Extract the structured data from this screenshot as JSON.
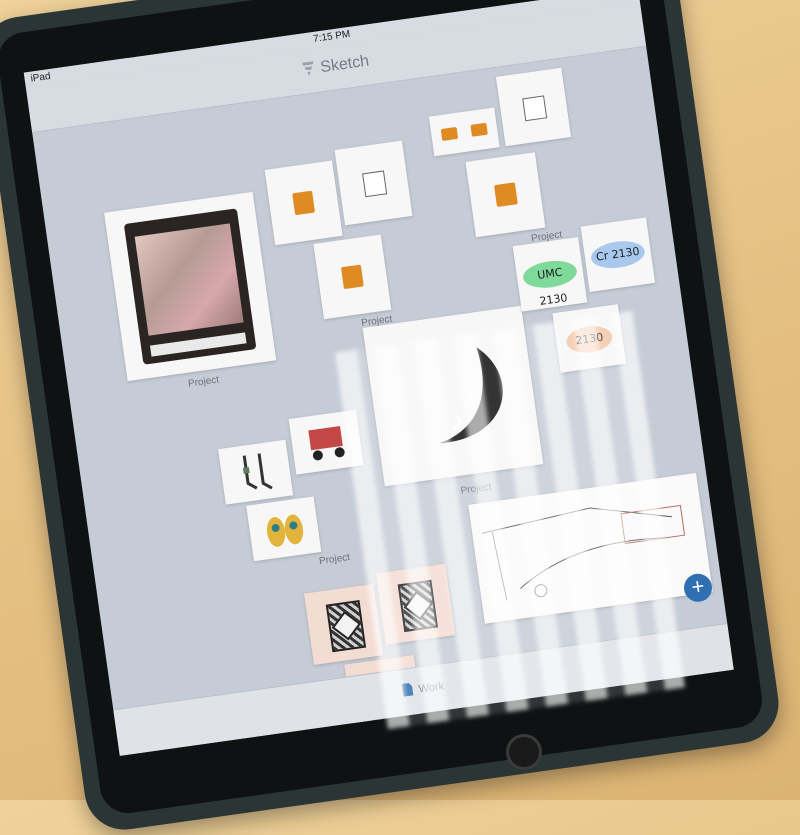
{
  "status_bar": {
    "device_label": "iPad",
    "time": "7:15 PM"
  },
  "nav": {
    "app_title": "Sketch",
    "app_icon": "fan-logo-icon"
  },
  "projects": [
    {
      "label": "Project"
    },
    {
      "label": "Project"
    },
    {
      "label": "Project"
    },
    {
      "label": "Project"
    },
    {
      "label": "Project"
    },
    {
      "label": "Project"
    }
  ],
  "badges": {
    "green": "UMC 2130",
    "blue": "Cr 2130",
    "peach": "2130"
  },
  "fab": {
    "symbol": "+"
  },
  "tab_bar": {
    "work_label": "Work"
  },
  "colors": {
    "accent": "#2f6fb2",
    "thumb_orange": "#e08a24",
    "badge_green": "#7ed99a",
    "badge_blue": "#a8c8ee"
  }
}
